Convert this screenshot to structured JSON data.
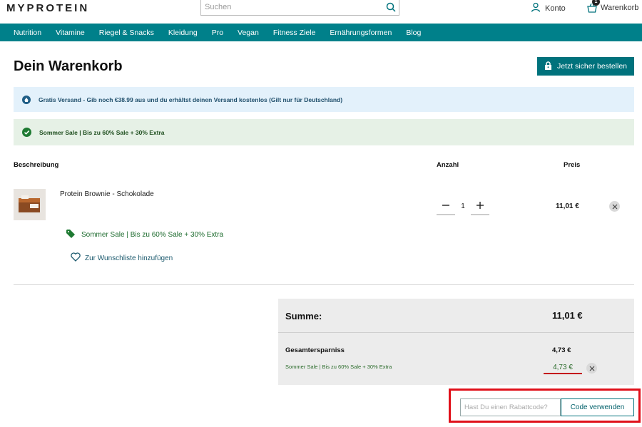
{
  "header": {
    "logo": "MYPROTEIN",
    "search_placeholder": "Suchen",
    "account_label": "Konto",
    "cart_label": "Warenkorb",
    "cart_count": "1"
  },
  "nav": {
    "items": [
      "Nutrition",
      "Vitamine",
      "Riegel & Snacks",
      "Kleidung",
      "Pro",
      "Vegan",
      "Fitness Ziele",
      "Ernährungsformen",
      "Blog"
    ]
  },
  "page": {
    "title": "Dein Warenkorb",
    "checkout_label": "Jetzt sicher bestellen"
  },
  "banners": {
    "shipping": "Gratis Versand - Gib noch €38.99 aus und du erhältst deinen Versand kostenlos (Gilt nur für Deutschland)",
    "sale": "Sommer Sale | Bis zu 60% Sale + 30% Extra"
  },
  "table": {
    "col_description": "Beschreibung",
    "col_quantity": "Anzahl",
    "col_price": "Preis"
  },
  "item": {
    "name": "Protein Brownie - Schokolade",
    "quantity": "1",
    "price": "11,01 €",
    "promo": "Sommer Sale | Bis zu 60% Sale + 30% Extra",
    "wishlist_label": "Zur Wunschliste hinzufügen"
  },
  "summary": {
    "total_label": "Summe:",
    "total_value": "11,01 €",
    "savings_label": "Gesamtersparniss",
    "savings_value": "4,73 €",
    "promo_line": "Sommer Sale | Bis zu 60% Sale + 30% Extra",
    "promo_amount": "4,73 €"
  },
  "coupon": {
    "placeholder": "Hast Du einen Rabattcode?",
    "button_label": "Code verwenden"
  },
  "colors": {
    "brand_teal": "#00808a",
    "highlight_red": "#e0101a"
  }
}
